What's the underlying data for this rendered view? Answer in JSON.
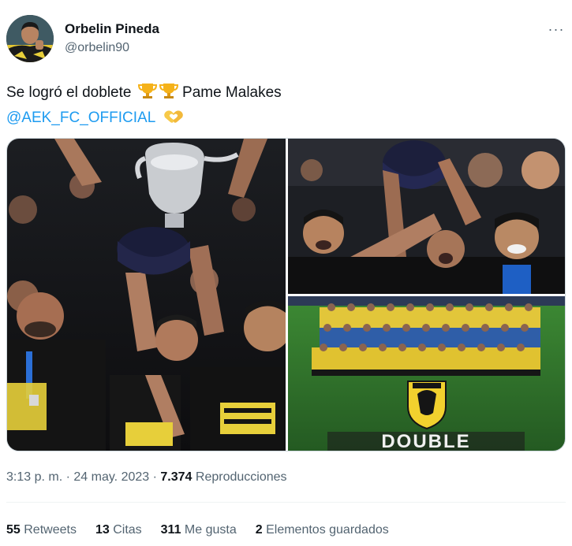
{
  "author": {
    "name": "Orbelin Pineda",
    "handle": "@orbelin90"
  },
  "more_label": "···",
  "tweet": {
    "text_line1": "Se logró el doblete",
    "text_suffix": "Pame Malakes",
    "mention": "@AEK_FC_OFFICIAL"
  },
  "media": {
    "photo_banner_text": "DOUBLE"
  },
  "meta": {
    "time": "3:13 p. m.",
    "separator": "·",
    "date": "24 may. 2023",
    "views_count": "7.374",
    "views_label": "Reproducciones"
  },
  "stats": {
    "retweets_count": "55",
    "retweets_label": "Retweets",
    "quotes_count": "13",
    "quotes_label": "Citas",
    "likes_count": "311",
    "likes_label": "Me gusta",
    "bookmarks_count": "2",
    "bookmarks_label": "Elementos guardados"
  },
  "colors": {
    "link": "#1d9bf0",
    "secondary_text": "#536471",
    "primary_text": "#0f1419",
    "aek_yellow": "#f2d12e"
  },
  "icons": [
    "trophy-emoji",
    "heart-hands-emoji",
    "more-icon"
  ]
}
